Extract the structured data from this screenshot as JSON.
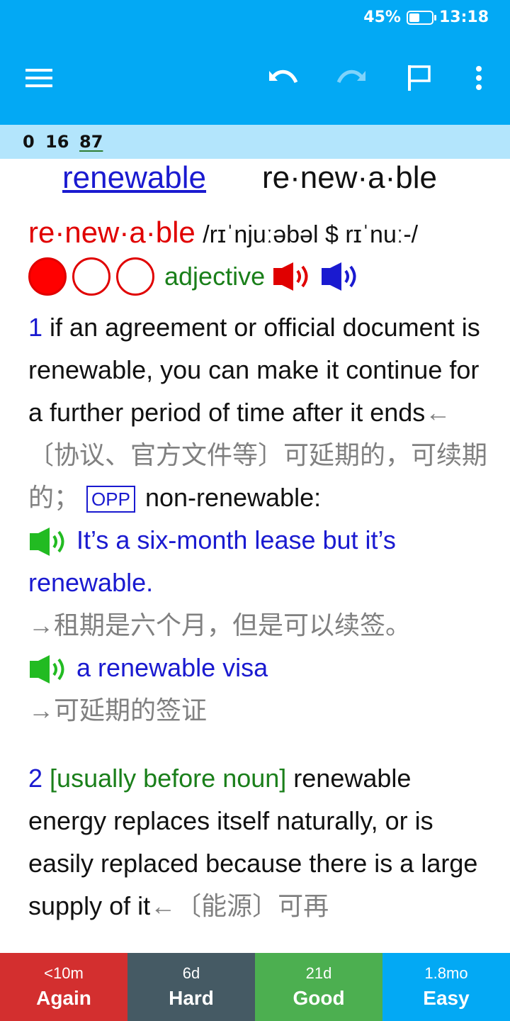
{
  "status_bar": {
    "battery": "45%",
    "time": "13:18",
    "battery_level": 0.45
  },
  "toolbar": {
    "icons": [
      "menu-icon",
      "undo-icon",
      "redo-icon",
      "flag-icon",
      "more-vert-icon"
    ]
  },
  "counts": {
    "new": "0",
    "learning": "16",
    "review": "87"
  },
  "card": {
    "front_word": "renewable",
    "front_syllables": "re·new·a·ble",
    "headword": "re·new·a·ble",
    "pronunciation": "/rɪˈnjuːəbəl $ rɪˈnuː-/",
    "frequency": {
      "filled": 1,
      "total": 3
    },
    "part_of_speech": "adjective",
    "sense1": {
      "number": "1",
      "definition": "if an agreement or official document is renewable, you can make it continue for a further period of time after it ends",
      "translation": "←〔协议、官方文件等〕可延期的，可续期的；",
      "opp_label": "OPP",
      "opposite": "non-renewable:",
      "example1": "It’s a six-month lease but it’s renewable.",
      "example1_cn": "→租期是六个月，但是可以续签。",
      "example2": "a renewable visa",
      "example2_cn": "→可延期的签证"
    },
    "sense2": {
      "number": "2",
      "grammar": "[usually before noun]",
      "definition": "renewable energy replaces itself naturally, or is easily replaced because there is a large supply of it",
      "translation": "←〔能源〕可再"
    }
  },
  "answers": [
    {
      "interval": "<10m",
      "label": "Again",
      "color": "#d32f2f"
    },
    {
      "interval": "6d",
      "label": "Hard",
      "color": "#455a64"
    },
    {
      "interval": "21d",
      "label": "Good",
      "color": "#4caf50"
    },
    {
      "interval": "1.8mo",
      "label": "Easy",
      "color": "#03a9f4"
    }
  ]
}
